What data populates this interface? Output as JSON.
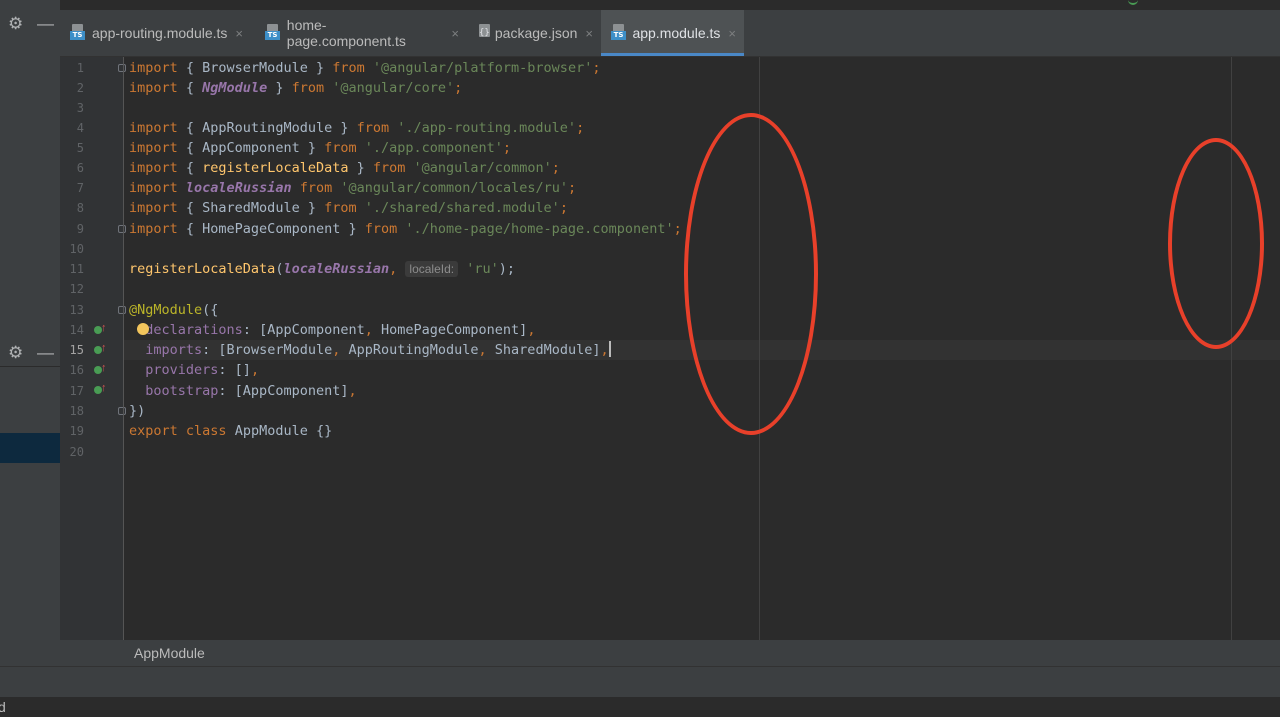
{
  "tabs": [
    {
      "label": "app-routing.module.ts",
      "icon": "ts-file-icon",
      "active": false
    },
    {
      "label": "home-page.component.ts",
      "icon": "ts-file-icon",
      "active": false
    },
    {
      "label": "package.json",
      "icon": "json-file-icon",
      "active": false
    },
    {
      "label": "app.module.ts",
      "icon": "ts-file-icon",
      "active": true
    }
  ],
  "tab_close_glyph": "×",
  "left_panel": {
    "settings_icon": "gear-icon",
    "hide_icon": "minimize-icon"
  },
  "editor": {
    "line_numbers": [
      "1",
      "2",
      "3",
      "4",
      "5",
      "6",
      "7",
      "8",
      "9",
      "10",
      "11",
      "12",
      "13",
      "14",
      "15",
      "16",
      "17",
      "18",
      "19",
      "20"
    ],
    "current_line": "15",
    "gutter_markers": [
      "14",
      "15",
      "16",
      "17"
    ],
    "code": {
      "l1": [
        "import",
        " { BrowserModule } ",
        "from",
        " ",
        "'@angular/platform-browser'",
        ";"
      ],
      "l2": [
        "import",
        " { ",
        "NgModule",
        " } ",
        "from",
        " ",
        "'@angular/core'",
        ";"
      ],
      "l4": [
        "import",
        " { AppRoutingModule } ",
        "from",
        " ",
        "'./app-routing.module'",
        ";"
      ],
      "l5": [
        "import",
        " { AppComponent } ",
        "from",
        " ",
        "'./app.component'",
        ";"
      ],
      "l6": [
        "import",
        " { ",
        "registerLocaleData",
        " } ",
        "from",
        " ",
        "'@angular/common'",
        ";"
      ],
      "l7": [
        "import",
        " ",
        "localeRussian",
        " ",
        "from",
        " ",
        "'@angular/common/locales/ru'",
        ";"
      ],
      "l8": [
        "import",
        " { SharedModule } ",
        "from",
        " ",
        "'./shared/shared.module'",
        ";"
      ],
      "l9": [
        "import",
        " { HomePageComponent } ",
        "from",
        " ",
        "'./home-page/home-page.component'",
        ";"
      ],
      "l11": [
        "registerLocaleData",
        "(",
        "localeRussian",
        ",",
        "localeId:",
        "'ru'",
        ");"
      ],
      "l13": [
        "@NgModule",
        "({"
      ],
      "l14": [
        "d",
        "eclarations",
        ": [AppComponent",
        ",",
        " HomePageComponent]",
        ","
      ],
      "l15": [
        "imports",
        ": [BrowserModule",
        ",",
        " AppRoutingModule",
        ",",
        " SharedModule]",
        ","
      ],
      "l16": [
        "providers",
        ": []",
        ","
      ],
      "l17": [
        "bootstrap",
        ": [AppComponent]",
        ","
      ],
      "l18": [
        "})"
      ],
      "l19": [
        "export",
        " ",
        "class",
        " AppModule {}"
      ]
    }
  },
  "breadcrumb": "AppModule",
  "bottom_text": "d",
  "colors": {
    "annotation": "#e8402a",
    "accent": "#4a88c7",
    "keyword": "#cc7832",
    "string": "#6a8759"
  }
}
